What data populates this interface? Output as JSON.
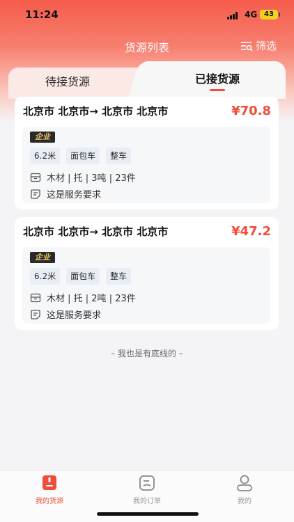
{
  "status": {
    "time": "11:24",
    "network": "4G",
    "battery": "43"
  },
  "header": {
    "title": "货源列表",
    "filter_label": "筛选"
  },
  "tabs": [
    {
      "label": "待接货源",
      "active": false
    },
    {
      "label": "已接货源",
      "active": true
    }
  ],
  "cards": [
    {
      "route": "北京市 北京市→ 北京市 北京市",
      "price": "¥70.8",
      "badge": "企业",
      "chips": [
        "6.2米",
        "面包车",
        "整车"
      ],
      "goods": "木材 | 托 | 3吨 | 23件",
      "service": "这是服务要求"
    },
    {
      "route": "北京市 北京市→ 北京市 北京市",
      "price": "¥47.2",
      "badge": "企业",
      "chips": [
        "6.2米",
        "面包车",
        "整车"
      ],
      "goods": "木材 | 托 | 2吨 | 23件",
      "service": "这是服务要求"
    }
  ],
  "footer_note": "– 我也是有底线的 –",
  "bottom_nav": [
    {
      "label": "我的货源",
      "active": true
    },
    {
      "label": "我的订单",
      "active": false
    },
    {
      "label": "我的",
      "active": false
    }
  ],
  "colors": {
    "accent": "#ef4d3a",
    "header_gradient_top": "#f55b4b",
    "background": "#f4f4f6"
  }
}
